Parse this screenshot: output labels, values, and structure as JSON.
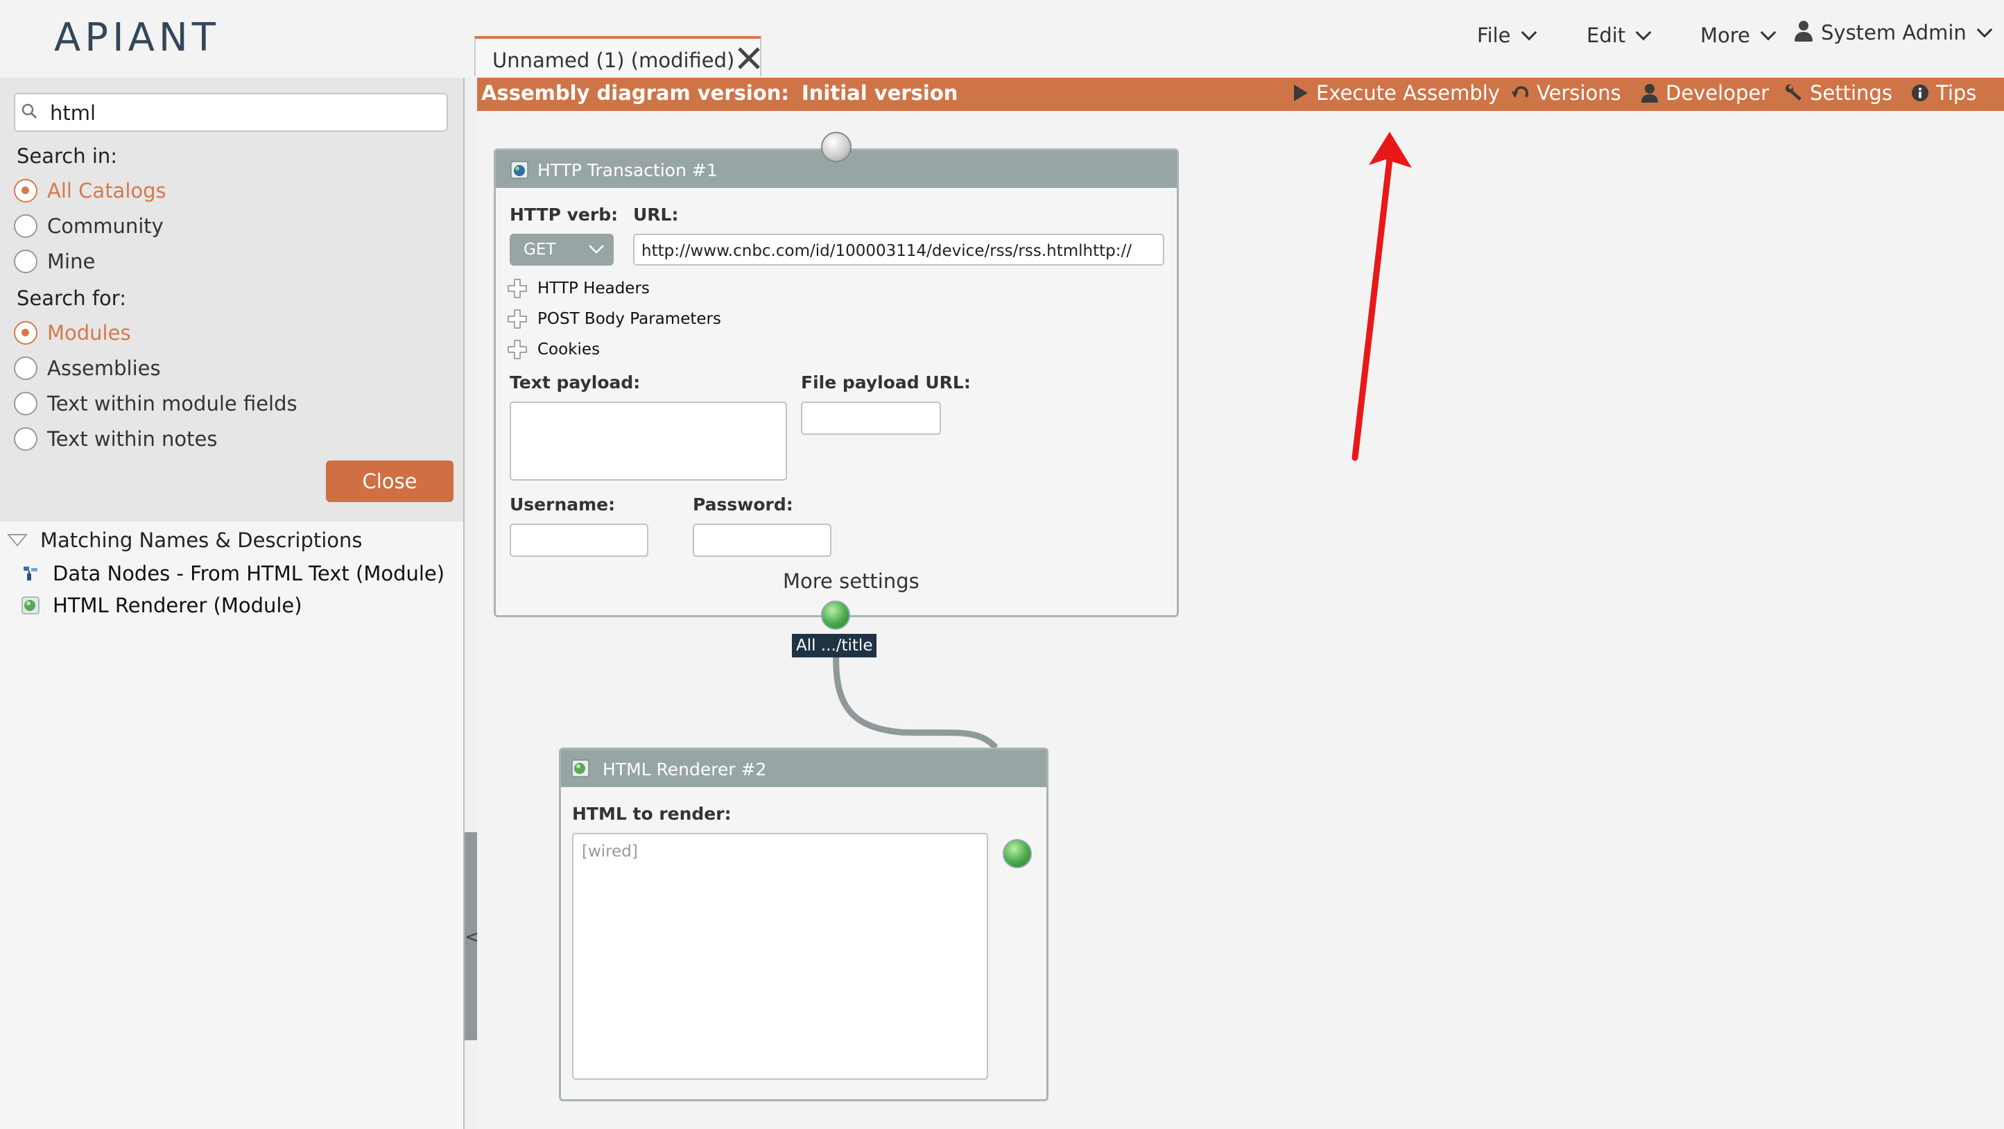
{
  "brand": {
    "logo_text": "APIANT"
  },
  "menu": {
    "file": "File",
    "edit": "Edit",
    "more": "More",
    "user": "System Admin"
  },
  "tab": {
    "label": "Unnamed (1) (modified)"
  },
  "search": {
    "value": "html",
    "search_in_label": "Search in:",
    "search_in_options": [
      "All Catalogs",
      "Community",
      "Mine"
    ],
    "search_for_label": "Search for:",
    "search_for_options": [
      "Modules",
      "Assemblies",
      "Text within module fields",
      "Text within notes"
    ],
    "close_label": "Close"
  },
  "results": {
    "header": "Matching Names & Descriptions",
    "items": [
      "Data Nodes - From HTML Text (Module)",
      "HTML Renderer (Module)"
    ]
  },
  "toolbar": {
    "version_label": "Assembly diagram version:",
    "version_value": "Initial version",
    "execute": "Execute Assembly",
    "versions": "Versions",
    "developer": "Developer",
    "settings": "Settings",
    "tips": "Tips",
    "color": "#cf7447"
  },
  "modules": {
    "http": {
      "title": "HTTP Transaction #1",
      "verb_label": "HTTP verb:",
      "verb_value": "GET",
      "url_label": "URL:",
      "url_value": "http://www.cnbc.com/id/100003114/device/rss/rss.htmlhttp://",
      "headers": "HTTP Headers",
      "post_body": "POST Body Parameters",
      "cookies": "Cookies",
      "text_payload_label": "Text payload:",
      "file_payload_label": "File payload URL:",
      "username_label": "Username:",
      "password_label": "Password:",
      "more_settings": "More settings",
      "output_tag": "All .../title"
    },
    "renderer": {
      "title": "HTML Renderer #2",
      "html_label": "HTML to render:",
      "html_placeholder": "[wired]"
    }
  }
}
